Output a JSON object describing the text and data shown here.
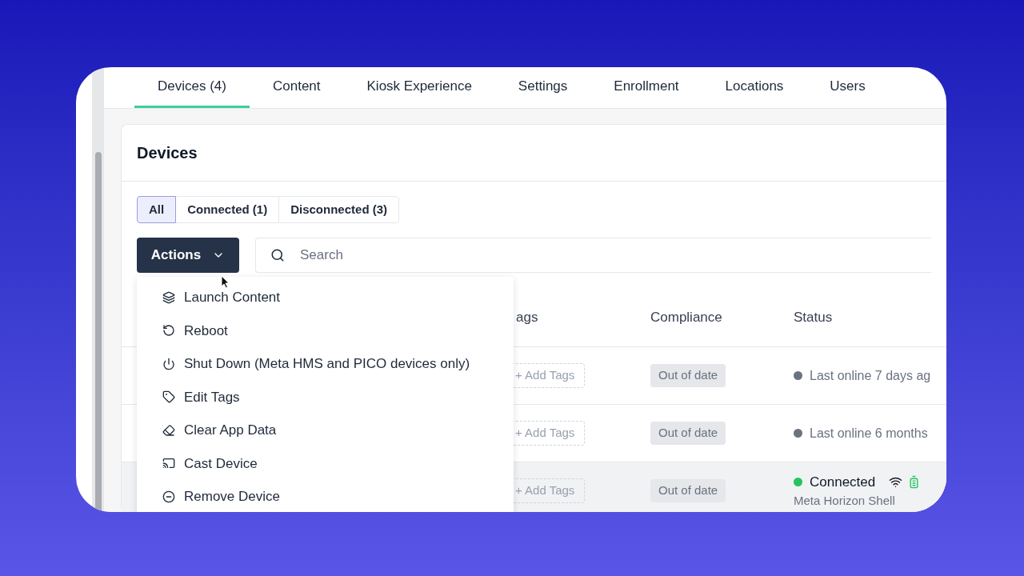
{
  "tabs": [
    {
      "label": "Devices (4)",
      "selected": true
    },
    {
      "label": "Content",
      "selected": false
    },
    {
      "label": "Kiosk Experience",
      "selected": false
    },
    {
      "label": "Settings",
      "selected": false
    },
    {
      "label": "Enrollment",
      "selected": false
    },
    {
      "label": "Locations",
      "selected": false
    },
    {
      "label": "Users",
      "selected": false
    }
  ],
  "card": {
    "title": "Devices"
  },
  "filters": [
    {
      "label": "All",
      "selected": true
    },
    {
      "label": "Connected (1)",
      "selected": false
    },
    {
      "label": "Disconnected (3)",
      "selected": false
    }
  ],
  "actions_button": {
    "label": "Actions"
  },
  "search": {
    "placeholder": "Search"
  },
  "actions_menu": [
    "Launch Content",
    "Reboot",
    "Shut Down (Meta HMS and PICO devices only)",
    "Edit Tags",
    "Clear App Data",
    "Cast Device",
    "Remove Device"
  ],
  "table": {
    "columns": [
      "ags",
      "Compliance",
      "Status"
    ],
    "rows": [
      {
        "tags": "+ Add Tags",
        "compliance": "Out of date",
        "status": "Last online 7 days ag",
        "kind": "offline",
        "color": "#6b7280",
        "highlighted": false
      },
      {
        "tags": "+ Add Tags",
        "compliance": "Out of date",
        "status": "Last online 6 months",
        "kind": "offline",
        "color": "#6b7280",
        "highlighted": false
      },
      {
        "tags": "+ Add Tags",
        "compliance": "Out of date",
        "status": "Connected",
        "detail": "Meta Horizon Shell",
        "kind": "online",
        "color": "#22c55e",
        "highlighted": true
      }
    ]
  }
}
